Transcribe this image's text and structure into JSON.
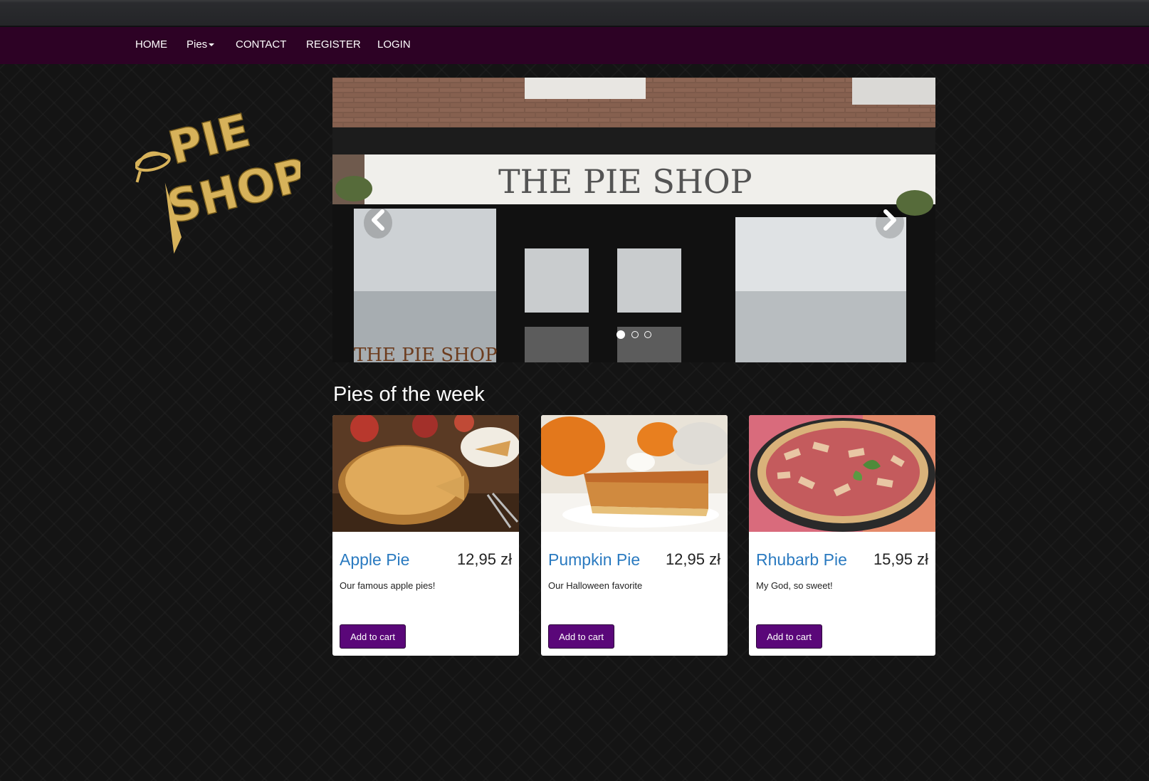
{
  "nav": {
    "home": "HOME",
    "pies": "Pies",
    "contact": "CONTACT",
    "register": "REGISTER",
    "login": "LOGIN"
  },
  "logo": {
    "text_top": "PIE",
    "text_bottom": "SHOP",
    "color": "#d7b25a"
  },
  "carousel": {
    "sign_text": "THE PIE SHOP",
    "window_text": "THE PIE SHOP",
    "slide_count": 3,
    "active_slide": 1
  },
  "section_title": "Pies of the week",
  "pies": [
    {
      "name": "Apple Pie",
      "price": "12,95 zł",
      "description": "Our famous apple pies!",
      "button": "Add to cart"
    },
    {
      "name": "Pumpkin Pie",
      "price": "12,95 zł",
      "description": "Our Halloween favorite",
      "button": "Add to cart"
    },
    {
      "name": "Rhubarb Pie",
      "price": "15,95 zł",
      "description": "My God, so sweet!",
      "button": "Add to cart"
    }
  ],
  "colors": {
    "navbar": "#2d0225",
    "accent_button": "#5a0779",
    "link": "#2a7ac0"
  }
}
